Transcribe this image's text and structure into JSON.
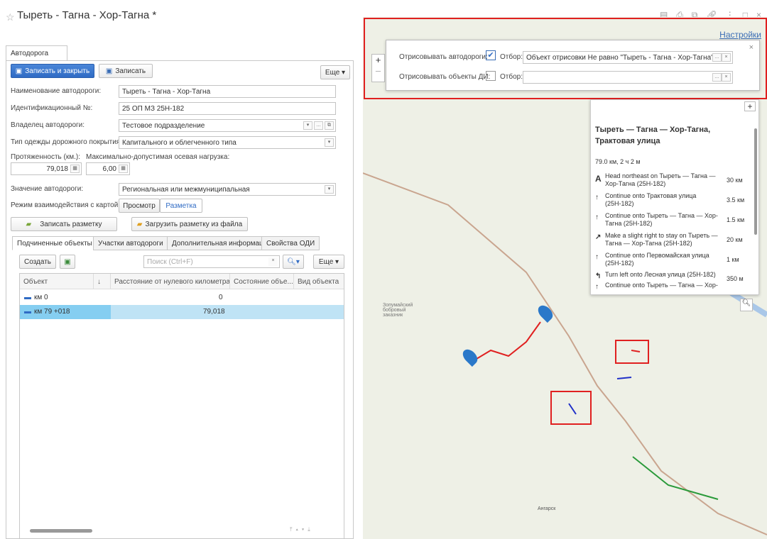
{
  "window": {
    "title": "Тыреть - Тагна - Хор-Тагна *"
  },
  "tab_main": "Автодорога",
  "toolbar": {
    "save_close": "Записать и закрыть",
    "save": "Записать",
    "more": "Еще"
  },
  "fields": {
    "name_label": "Наименование автодороги:",
    "name_value": "Тыреть - Тагна - Хор-Тагна",
    "id_label": "Идентификационный №:",
    "id_value": "25 ОП МЗ 25Н-182",
    "owner_label": "Владелец автодороги:",
    "owner_value": "Тестовое подразделение",
    "surface_label": "Тип одежды дорожного покрытия:",
    "surface_value": "Капитального и облегченного типа",
    "length_label": "Протяженность (км.):",
    "length_value": "79,018",
    "axle_label": "Максимально-допустимая осевая нагрузка:",
    "axle_value": "6,00",
    "importance_label": "Значение автодороги:",
    "importance_value": "Региональная или межмуниципальная",
    "mode_label": "Режим взаимодействия с картой:",
    "mode_view": "Просмотр",
    "mode_markup": "Разметка"
  },
  "markup": {
    "save": "Записать разметку",
    "load": "Загрузить разметку из файла"
  },
  "subtabs": [
    "Подчиненные объекты",
    "Участки автодороги",
    "Дополнительная информация",
    "Свойства ОДИ"
  ],
  "grid_toolbar": {
    "create": "Создать",
    "search_placeholder": "Поиск (Ctrl+F)",
    "more": "Еще"
  },
  "grid": {
    "headers": [
      "Объект",
      "↓",
      "Расстояние от нулевого километра",
      "Состояние объе...",
      "Вид объекта"
    ],
    "rows": [
      {
        "object": "км 0",
        "distance": "0"
      },
      {
        "object": "км 79 +018",
        "distance": "79,018"
      }
    ]
  },
  "map": {
    "settings_link": "Настройки",
    "filter1_label": "Отрисовывать автодороги:",
    "filter1_otbor": "Отбор:",
    "filter1_value": "Объект отрисовки Не равно \"Тыреть - Тагна - Хор-Тагна\"",
    "filter2_label": "Отрисовывать объекты ДИ:",
    "filter2_otbor": "Отбор:",
    "filter2_value": "",
    "reserve_label": "Зопумайский бобровый заказник",
    "town_label": "Ангарск",
    "route_title": "Тыреть — Тагна — Хор-Тагна, Трактовая улица",
    "route_summary": "79.0 км, 2 ч 2 м",
    "steps": [
      {
        "icon": "A",
        "text": "Head northeast on Тыреть — Тагна — Хор-Тагна (25Н-182)",
        "dist": "30 км"
      },
      {
        "icon": "↑",
        "text": "Continue onto Трактовая улица (25Н-182)",
        "dist": "3.5 км"
      },
      {
        "icon": "↑",
        "text": "Continue onto Тыреть — Тагна — Хор-Тагна (25Н-182)",
        "dist": "1.5 км"
      },
      {
        "icon": "↗",
        "text": "Make a slight right to stay on Тыреть — Тагна — Хор-Тагна (25Н-182)",
        "dist": "20 км"
      },
      {
        "icon": "↑",
        "text": "Continue onto Первомайская улица (25Н-182)",
        "dist": "1 км"
      },
      {
        "icon": "↰",
        "text": "Turn left onto Лесная улица (25Н-182)",
        "dist": "350 м"
      },
      {
        "icon": "↑",
        "text": "Continue onto Тыреть — Тагна — Хор-",
        "dist": ""
      }
    ]
  },
  "colors": {
    "accent": "#2f6bc4",
    "highlight": "#bfe3f5",
    "red": "#e02020"
  }
}
